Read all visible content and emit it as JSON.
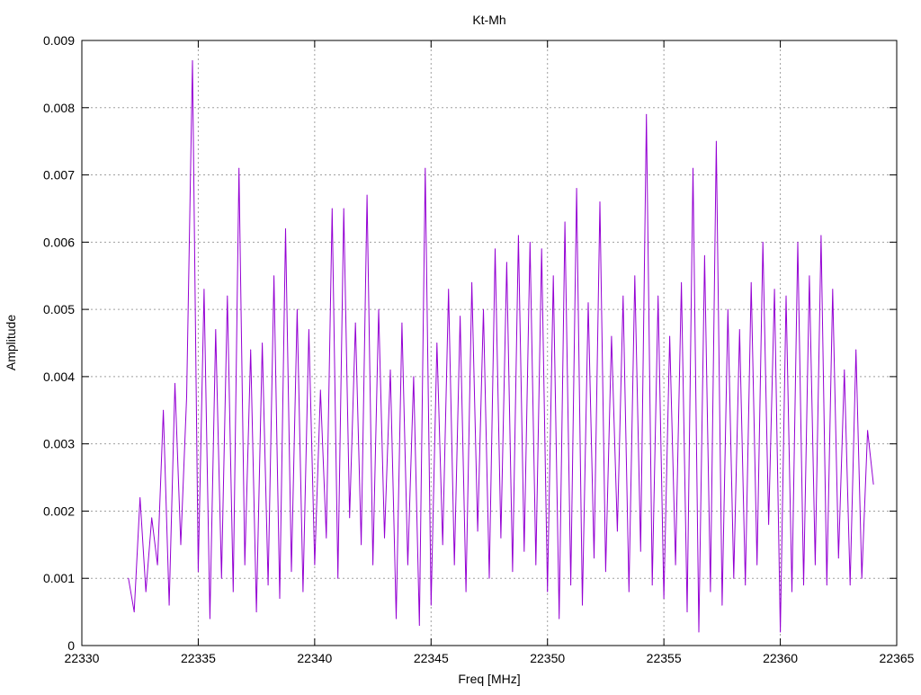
{
  "chart_data": {
    "type": "line",
    "title": "Kt-Mh",
    "xlabel": "Freq [MHz]",
    "ylabel": "Amplitude",
    "xlim": [
      22330,
      22365
    ],
    "ylim": [
      0,
      0.009
    ],
    "xticks": [
      "22330",
      "22335",
      "22340",
      "22345",
      "22350",
      "22355",
      "22360",
      "22365"
    ],
    "yticks": [
      "0",
      "0.001",
      "0.002",
      "0.003",
      "0.004",
      "0.005",
      "0.006",
      "0.007",
      "0.008",
      "0.009"
    ],
    "grid": true,
    "legend": "none",
    "series": [
      {
        "name": "Kt-Mh",
        "color": "#9400d3",
        "x_start": 22332,
        "x_step": 0.25,
        "values": [
          0.001,
          0.0005,
          0.0022,
          0.0008,
          0.0019,
          0.0012,
          0.0035,
          0.0006,
          0.0039,
          0.0015,
          0.0037,
          0.0087,
          0.0011,
          0.0053,
          0.0004,
          0.0047,
          0.001,
          0.0052,
          0.0008,
          0.0071,
          0.0012,
          0.0044,
          0.0005,
          0.0045,
          0.0009,
          0.0055,
          0.0007,
          0.0062,
          0.0011,
          0.005,
          0.0008,
          0.0047,
          0.0012,
          0.0038,
          0.0016,
          0.0065,
          0.001,
          0.0065,
          0.0019,
          0.0048,
          0.0015,
          0.0067,
          0.0012,
          0.005,
          0.0016,
          0.0041,
          0.0004,
          0.0048,
          0.0012,
          0.004,
          0.0003,
          0.0071,
          0.0006,
          0.0045,
          0.0015,
          0.0053,
          0.0012,
          0.0049,
          0.0008,
          0.0054,
          0.0017,
          0.005,
          0.001,
          0.0059,
          0.0016,
          0.0057,
          0.0011,
          0.0061,
          0.0014,
          0.006,
          0.0012,
          0.0059,
          0.0008,
          0.0055,
          0.0004,
          0.0063,
          0.0009,
          0.0068,
          0.0006,
          0.0051,
          0.0013,
          0.0066,
          0.0011,
          0.0046,
          0.0017,
          0.0052,
          0.0008,
          0.0055,
          0.0014,
          0.0079,
          0.0009,
          0.0052,
          0.0007,
          0.0046,
          0.0012,
          0.0054,
          0.0005,
          0.0071,
          0.0002,
          0.0058,
          0.0008,
          0.0075,
          0.0006,
          0.005,
          0.001,
          0.0047,
          0.0009,
          0.0054,
          0.0012,
          0.006,
          0.0018,
          0.0053,
          0.0002,
          0.0052,
          0.0008,
          0.006,
          0.0009,
          0.0055,
          0.0012,
          0.0061,
          0.0009,
          0.0053,
          0.0013,
          0.0041,
          0.0009,
          0.0044,
          0.001,
          0.0032,
          0.0024
        ]
      }
    ]
  }
}
